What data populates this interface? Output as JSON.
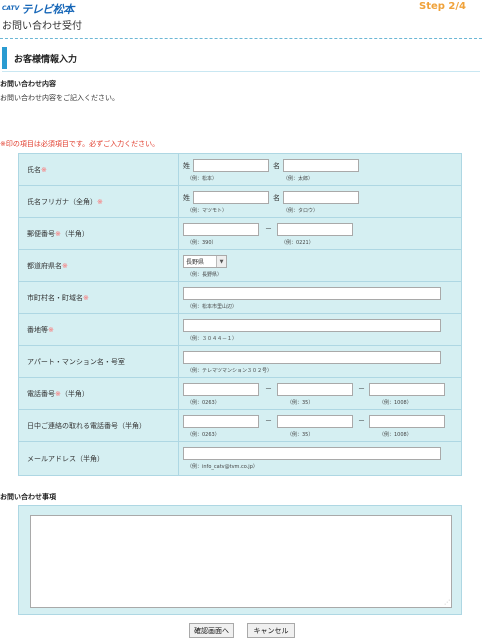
{
  "header": {
    "logo_mark": "CATV",
    "logo_text": "テレビ松本",
    "page_title": "お問い合わせ受付",
    "step": "Step 2/4"
  },
  "section": {
    "title": "お客様情報入力"
  },
  "inquiry": {
    "heading": "お問い合わせ内容",
    "description": "お問い合わせ内容をご記入ください。"
  },
  "required_note": "※印の項目は必須項目です。必ずご入力ください。",
  "form": {
    "name": {
      "label": "氏名",
      "mark": "※",
      "sei": "姓",
      "mei": "名",
      "ex_sei": "（例：松本）",
      "ex_mei": "（例：太郎）"
    },
    "kana": {
      "label": "氏名フリガナ（全角）",
      "mark": "※",
      "sei": "姓",
      "mei": "名",
      "ex_sei": "（例：マツモト）",
      "ex_mei": "（例：タロウ）"
    },
    "postal": {
      "label": "郵便番号",
      "mark": "※",
      "suffix": "（半角）",
      "dash": "－",
      "ex1": "（例：390）",
      "ex2": "（例：0221）"
    },
    "prefecture": {
      "label": "都道府県名",
      "mark": "※",
      "value": "長野県",
      "ex": "（例：長野県）"
    },
    "city": {
      "label": "市町村名・町域名",
      "mark": "※",
      "ex": "（例：松本市里山辺）"
    },
    "address": {
      "label": "番地等",
      "mark": "※",
      "ex": "（例：３０４４－１）"
    },
    "building": {
      "label": "アパート・マンション名・号室",
      "ex": "（例：テレマツマンション３０２号）"
    },
    "phone": {
      "label": "電話番号",
      "mark": "※",
      "suffix": "（半角）",
      "dash": "－",
      "ex1": "（例：0263）",
      "ex2": "（例：35）",
      "ex3": "（例：1008）"
    },
    "day_phone": {
      "label": "日中ご連絡の取れる電話番号（半角）",
      "dash": "－",
      "ex1": "（例：0263）",
      "ex2": "（例：35）",
      "ex3": "（例：1008）"
    },
    "email": {
      "label": "メールアドレス（半角）",
      "ex": "（例：info_catv@tvm.co.jp）"
    }
  },
  "message": {
    "heading": "お問い合わせ事項"
  },
  "buttons": {
    "confirm": "確認画面へ",
    "cancel": "キャンセル"
  },
  "colors": {
    "accent": "#2a9bd1",
    "step": "#f0a23a",
    "required": "#e03a2a",
    "row_bg": "#d5eff2",
    "logo": "#1767b8"
  }
}
